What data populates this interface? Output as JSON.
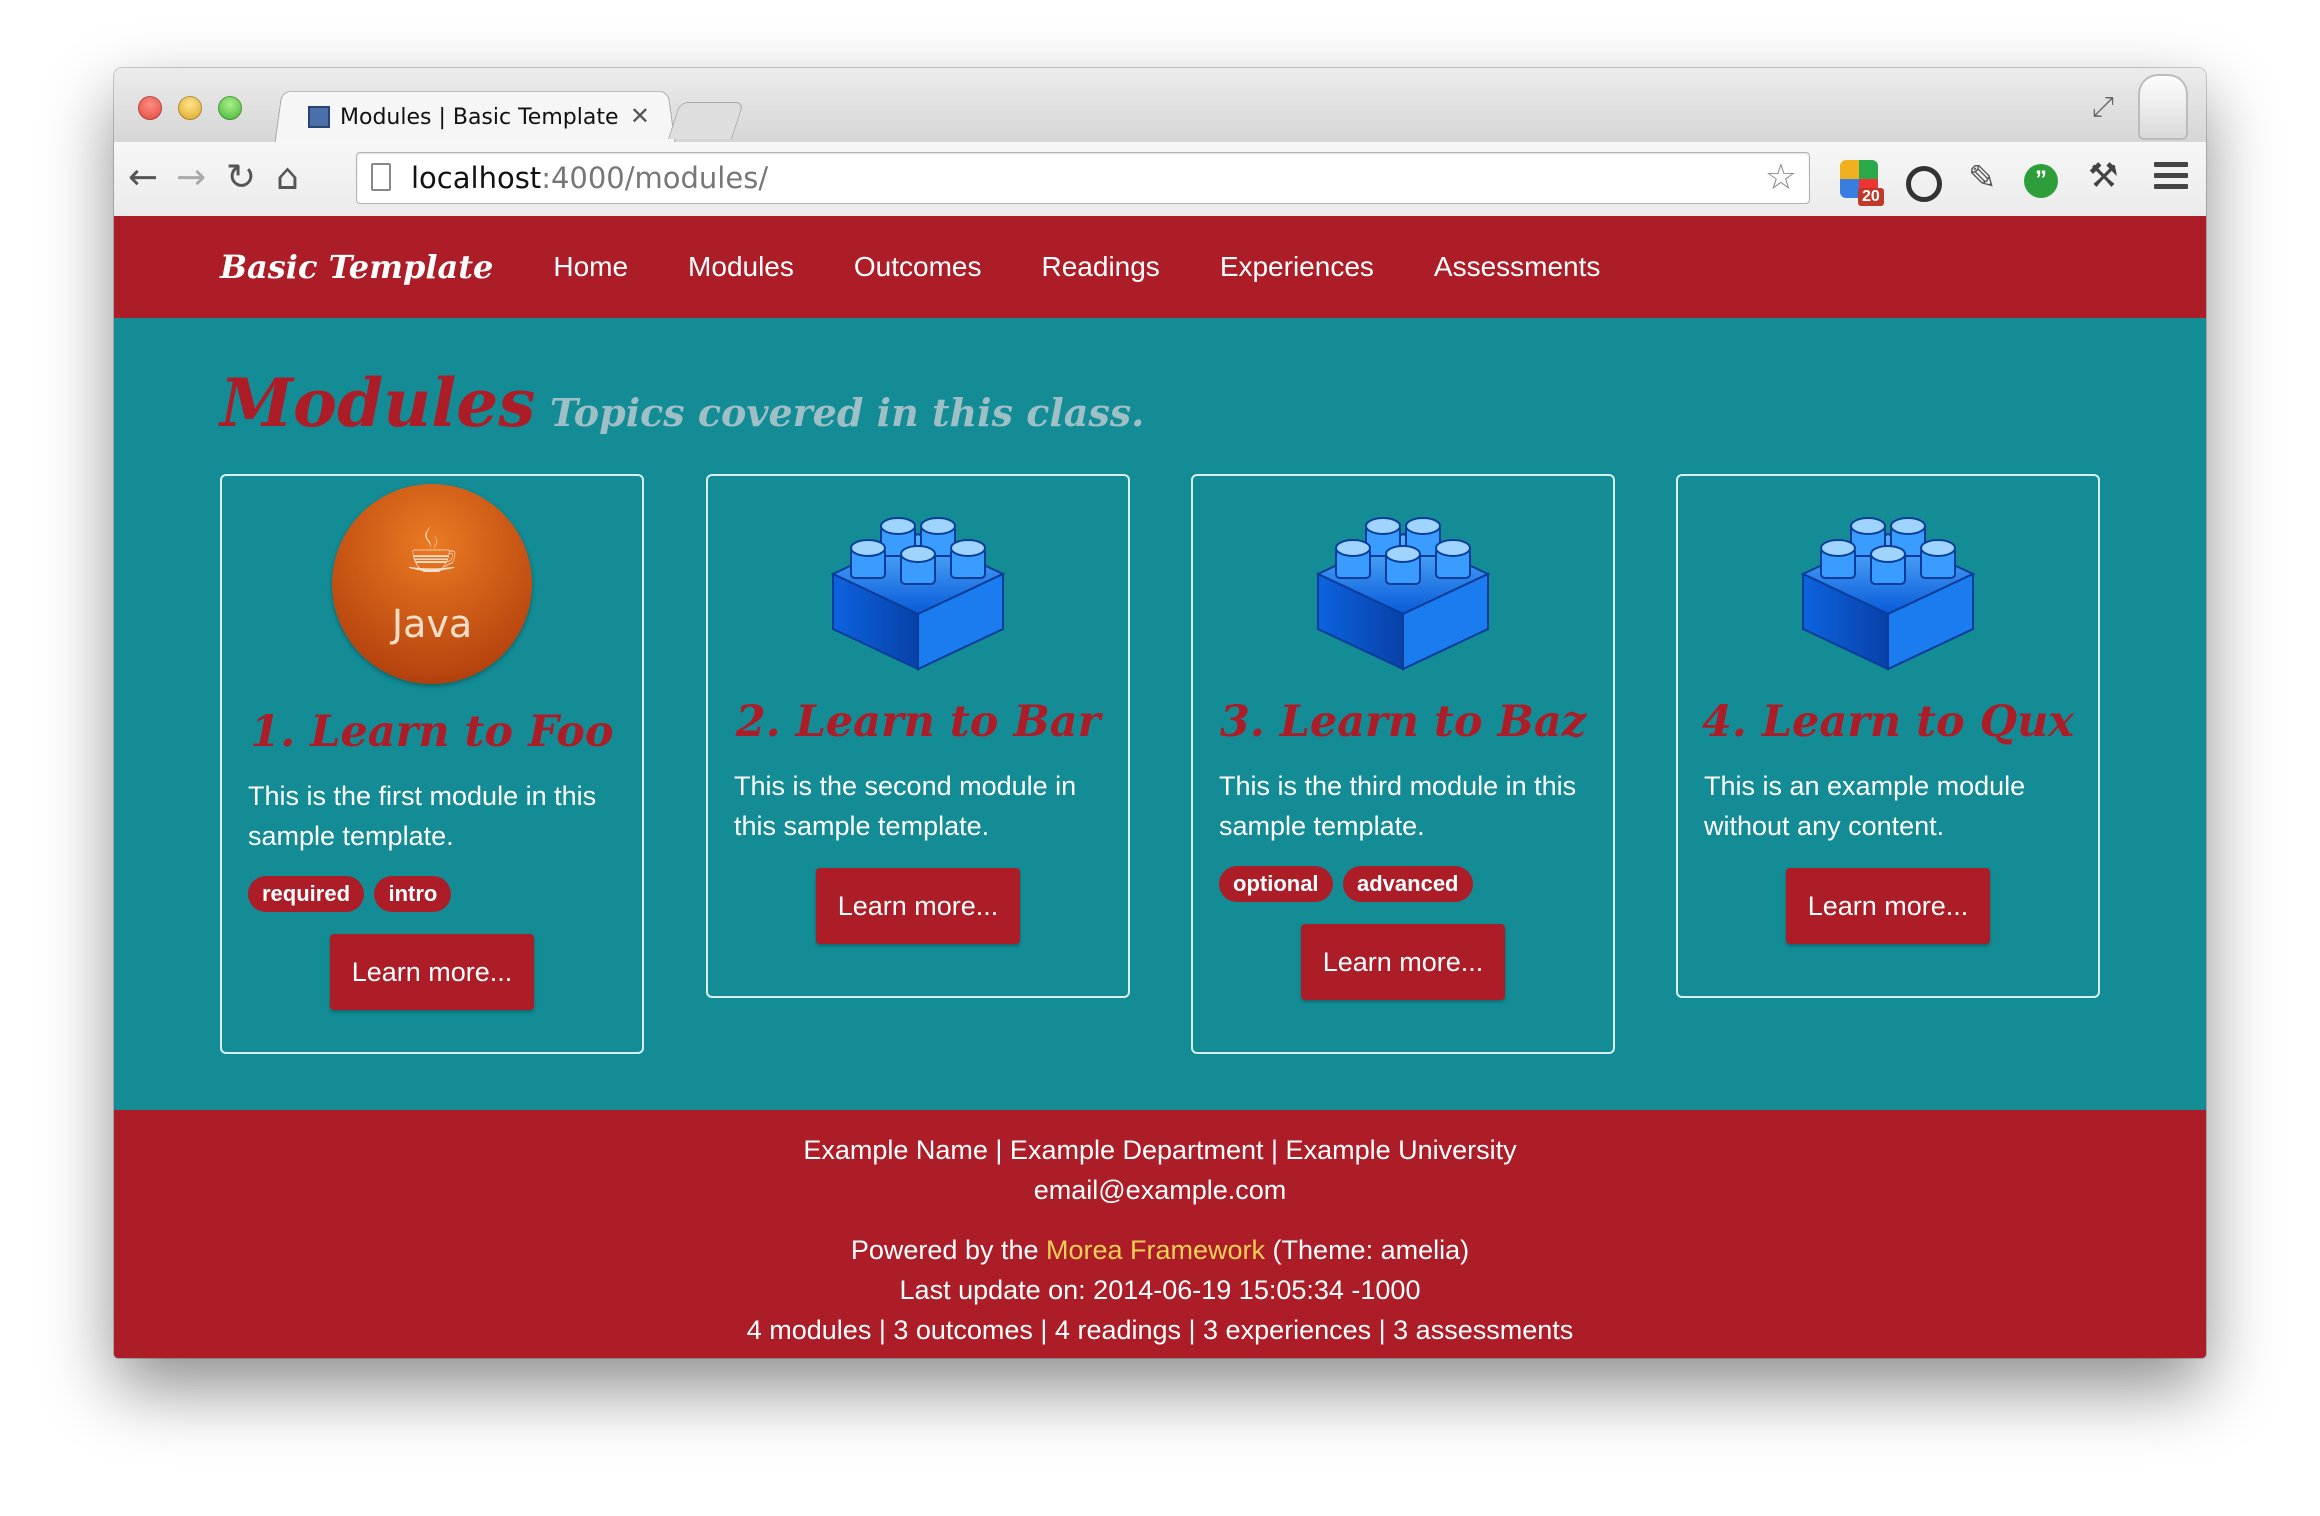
{
  "browser": {
    "tab_title": "Modules | Basic Template",
    "url_host": "localhost",
    "url_rest": ":4000/modules/",
    "ext_badge": "20"
  },
  "navbar": {
    "brand": "Basic Template",
    "links": [
      "Home",
      "Modules",
      "Outcomes",
      "Readings",
      "Experiences",
      "Assessments"
    ]
  },
  "heading": {
    "title": "Modules",
    "subtitle": "Topics covered in this class."
  },
  "modules": [
    {
      "title": "1. Learn to Foo",
      "description": "This is the first module in this sample template.",
      "labels": [
        "required",
        "intro"
      ],
      "button": "Learn more...",
      "icon": "java-icon",
      "icon_text": "Java"
    },
    {
      "title": "2. Learn to Bar",
      "description": "This is the second module in this sample template.",
      "labels": [],
      "button": "Learn more...",
      "icon": "lego-block-icon"
    },
    {
      "title": "3. Learn to Baz",
      "description": "This is the third module in this sample template.",
      "labels": [
        "optional",
        "advanced"
      ],
      "button": "Learn more...",
      "icon": "lego-block-icon"
    },
    {
      "title": "4. Learn to Qux",
      "description": "This is an example module without any content.",
      "labels": [],
      "button": "Learn more...",
      "icon": "lego-block-icon"
    }
  ],
  "footer": {
    "contact": "Example Name | Example Department | Example University",
    "email": "email@example.com",
    "powered_prefix": "Powered by the ",
    "powered_link": "Morea Framework",
    "powered_suffix": " (Theme: amelia)",
    "last_update": "Last update on: 2014-06-19 15:05:34 -1000",
    "counts": "4 modules | 3 outcomes | 4 readings | 3 experiences | 3 assessments"
  },
  "colors": {
    "accent_red": "#ad1d28",
    "page_teal": "#138c95",
    "link_yellow": "#f2cf55"
  }
}
